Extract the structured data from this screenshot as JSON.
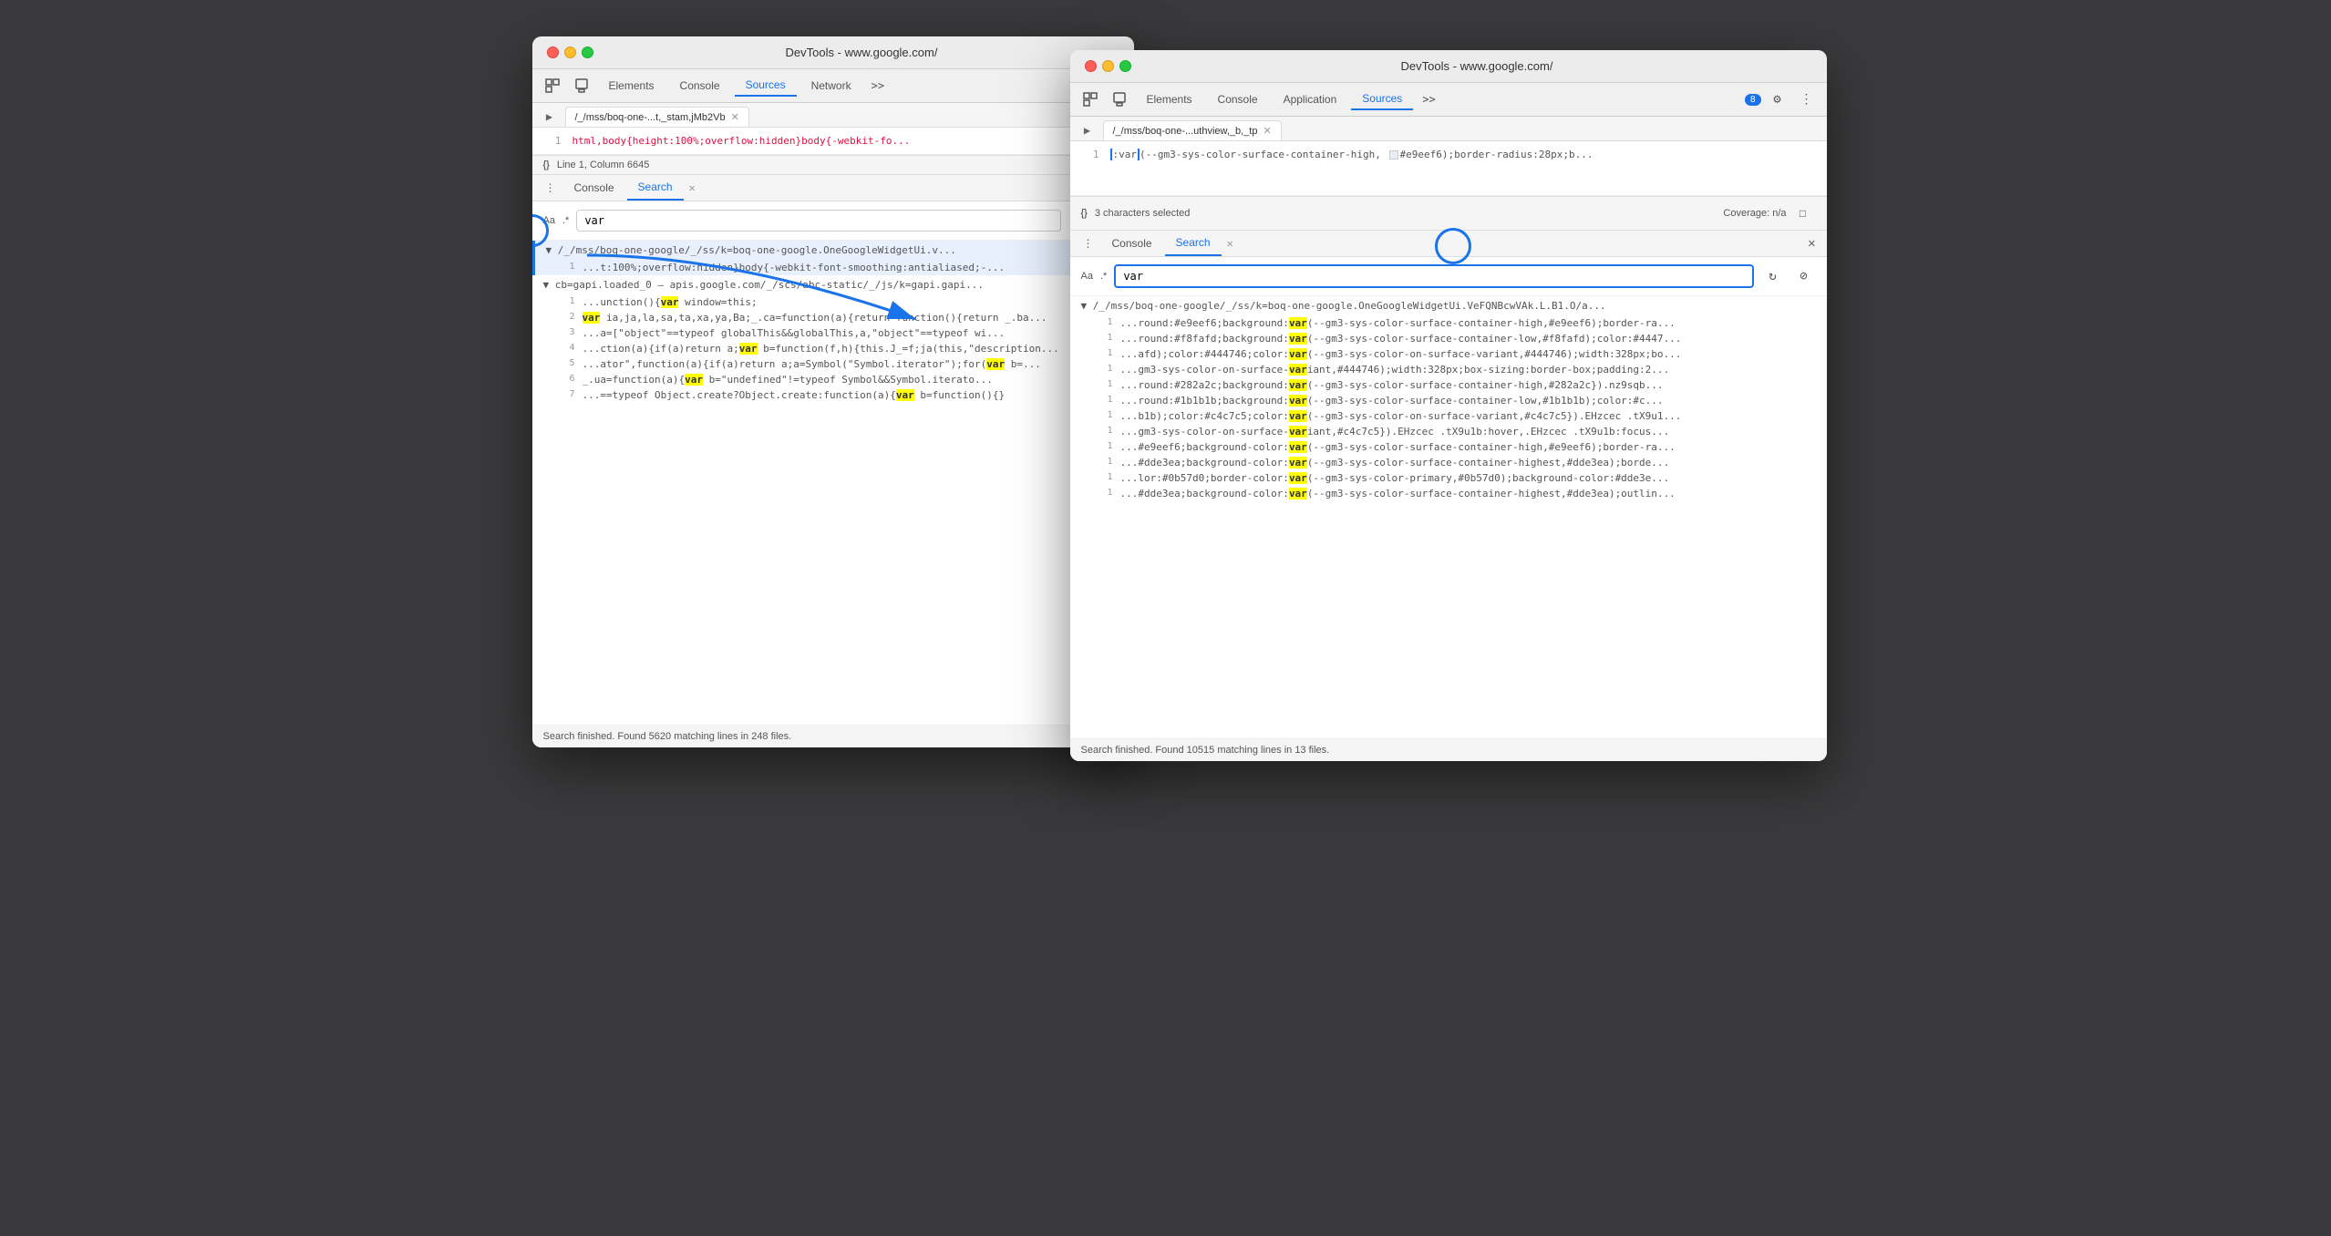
{
  "window_left": {
    "title": "DevTools - www.google.com/",
    "tabs": [
      "Elements",
      "Console",
      "Sources",
      "Network",
      ">>"
    ],
    "active_tab": "Sources",
    "file_tab": "/_/mss/boq-one-...t,_stam,jMb2Vb",
    "code_line": "html,body{height:100%;overflow:hidden}body{-webkit-fo...",
    "line_number": "1",
    "status": "Line 1, Column 6645",
    "panel_tabs": [
      "Console",
      "Search"
    ],
    "active_panel_tab": "Search",
    "search_input_value": "var",
    "search_option_aa": "Aa",
    "search_option_regex": ".*",
    "result_file1": "▼ /_/mss/boq-one-google/_/ss/k=boq-one-google.OneGoogleWidgetUi.v...",
    "result_rows1": [
      {
        "line": "1",
        "text": "...t:100%;overflow:hidden}body{-webkit-font-smoothing:antialiased;-..."
      }
    ],
    "result_file2": "▼ cb=gapi.loaded_0  —  apis.google.com/_/scs/abc-static/_/js/k=gapi.gapi...",
    "result_rows2": [
      {
        "line": "1",
        "text": "...unction(){var window=this;"
      },
      {
        "line": "2",
        "text": "var ia,ja,la,sa,ta,xa,ya,Ba;_.ca=function(a){return function(){return _.ba..."
      },
      {
        "line": "3",
        "text": "...a=[\"object\"==typeof globalThis&&globalThis,a,\"object\"==typeof wi..."
      },
      {
        "line": "4",
        "text": "...ction(a){if(a)return a;var b=function(f,h){this.J_=f;ja(this,\"description..."
      },
      {
        "line": "5",
        "text": "...ator\",function(a){if(a)return a;a=Symbol(\"Symbol.iterator\");for(var b=..."
      },
      {
        "line": "6",
        "text": "_.ua=function(a){var b=\"undefined\"!=typeof Symbol&&Symbol.iterato..."
      },
      {
        "line": "7",
        "text": "...==typeof Object.create?Object.create:function(a){var b=function(){}"
      }
    ],
    "search_footer": "Search finished.  Found 5620 matching lines in 248 files."
  },
  "window_right": {
    "title": "DevTools - www.google.com/",
    "tabs": [
      "Elements",
      "Console",
      "Application",
      "Sources",
      ">>"
    ],
    "active_tab": "Sources",
    "badge_count": "8",
    "file_tab": "/_/mss/boq-one-...uthview,_b,_tp",
    "code_line_num": "1",
    "code_content": ":var(--gm3-sys-color-surface-container-high,",
    "code_color": "#e9eef6",
    "code_suffix": ");border-radius:28px;b...",
    "status": "3 characters selected",
    "coverage": "Coverage: n/a",
    "panel_tabs": [
      "Console",
      "Search"
    ],
    "active_panel_tab": "Search",
    "search_input_value": "var",
    "result_file1": "▼ /_/mss/boq-one-google/_/ss/k=boq-one-google.OneGoogleWidgetUi.VeFQNBcwVAk.L.B1.O/a...",
    "result_rows": [
      {
        "line": "1",
        "text": "...round:#e9eef6;background:var(--gm3-sys-color-surface-container-high,#e9eef6);border-ra..."
      },
      {
        "line": "1",
        "text": "...round:#f8fafd;background:var(--gm3-sys-color-surface-container-low,#f8fafd);color:#4447..."
      },
      {
        "line": "1",
        "text": "...afd);color:#444746;color:var(--gm3-sys-color-on-surface-variant,#444746);width:328px;bo..."
      },
      {
        "line": "1",
        "text": "...gm3-sys-color-on-surface-variant,#444746);width:328px;box-sizing:border-box;padding:2..."
      },
      {
        "line": "1",
        "text": "...round:#282a2c;background:var(--gm3-sys-color-surface-container-high,#282a2c}).nz9sqb..."
      },
      {
        "line": "1",
        "text": "...round:#1b1b1b;background:var(--gm3-sys-color-surface-container-low,#1b1b1b);color:#c..."
      },
      {
        "line": "1",
        "text": "...b1b);color:#c4c7c5;color:var(--gm3-sys-color-on-surface-variant,#c4c7c5}).EHzcec .tX9u1..."
      },
      {
        "line": "1",
        "text": "...gm3-sys-color-on-surface-variant,#c4c7c5}).EHzcec .tX9u1b:hover,.EHzcec .tX9u1b:focus..."
      },
      {
        "line": "1",
        "text": "...#e9eef6;background-color:var(--gm3-sys-color-surface-container-high,#e9eef6);border-ra..."
      },
      {
        "line": "1",
        "text": "...#dde3ea;background-color:var(--gm3-sys-color-surface-container-highest,#dde3ea);borde..."
      },
      {
        "line": "1",
        "text": "...lor:#0b57d0;border-color:var(--gm3-sys-color-primary,#0b57d0);background-color:#dde3e..."
      },
      {
        "line": "1",
        "text": "...#dde3ea;background-color:var(--gm3-sys-color-surface-container-highest,#dde3ea);outlin..."
      }
    ],
    "search_footer": "Search finished.  Found 10515 matching lines in 13 files."
  }
}
